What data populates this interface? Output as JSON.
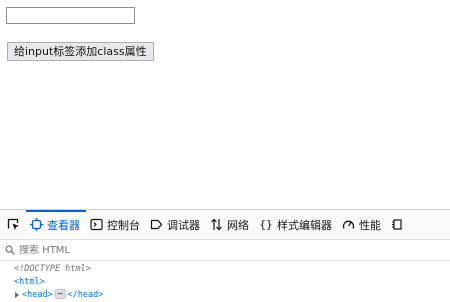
{
  "page": {
    "input_value": "",
    "button_label": "给input标签添加class属性"
  },
  "devtools": {
    "tabs": [
      {
        "label": "查看器",
        "icon": "inspector-icon",
        "active": true
      },
      {
        "label": "控制台",
        "icon": "console-icon",
        "active": false
      },
      {
        "label": "调试器",
        "icon": "debugger-icon",
        "active": false
      },
      {
        "label": "网络",
        "icon": "network-icon",
        "active": false
      },
      {
        "label": "样式编辑器",
        "icon": "style-editor-icon",
        "active": false
      },
      {
        "label": "性能",
        "icon": "performance-icon",
        "active": false
      }
    ],
    "search_placeholder": "搜索 HTML",
    "markup": {
      "doctype": "<!DOCTYPE html>",
      "html_open": "<html>",
      "head_open": "<head>",
      "ellipsis": "⋯",
      "head_close": "</head>"
    },
    "colors": {
      "accent": "#0061e0",
      "tag": "#0074e8"
    }
  }
}
